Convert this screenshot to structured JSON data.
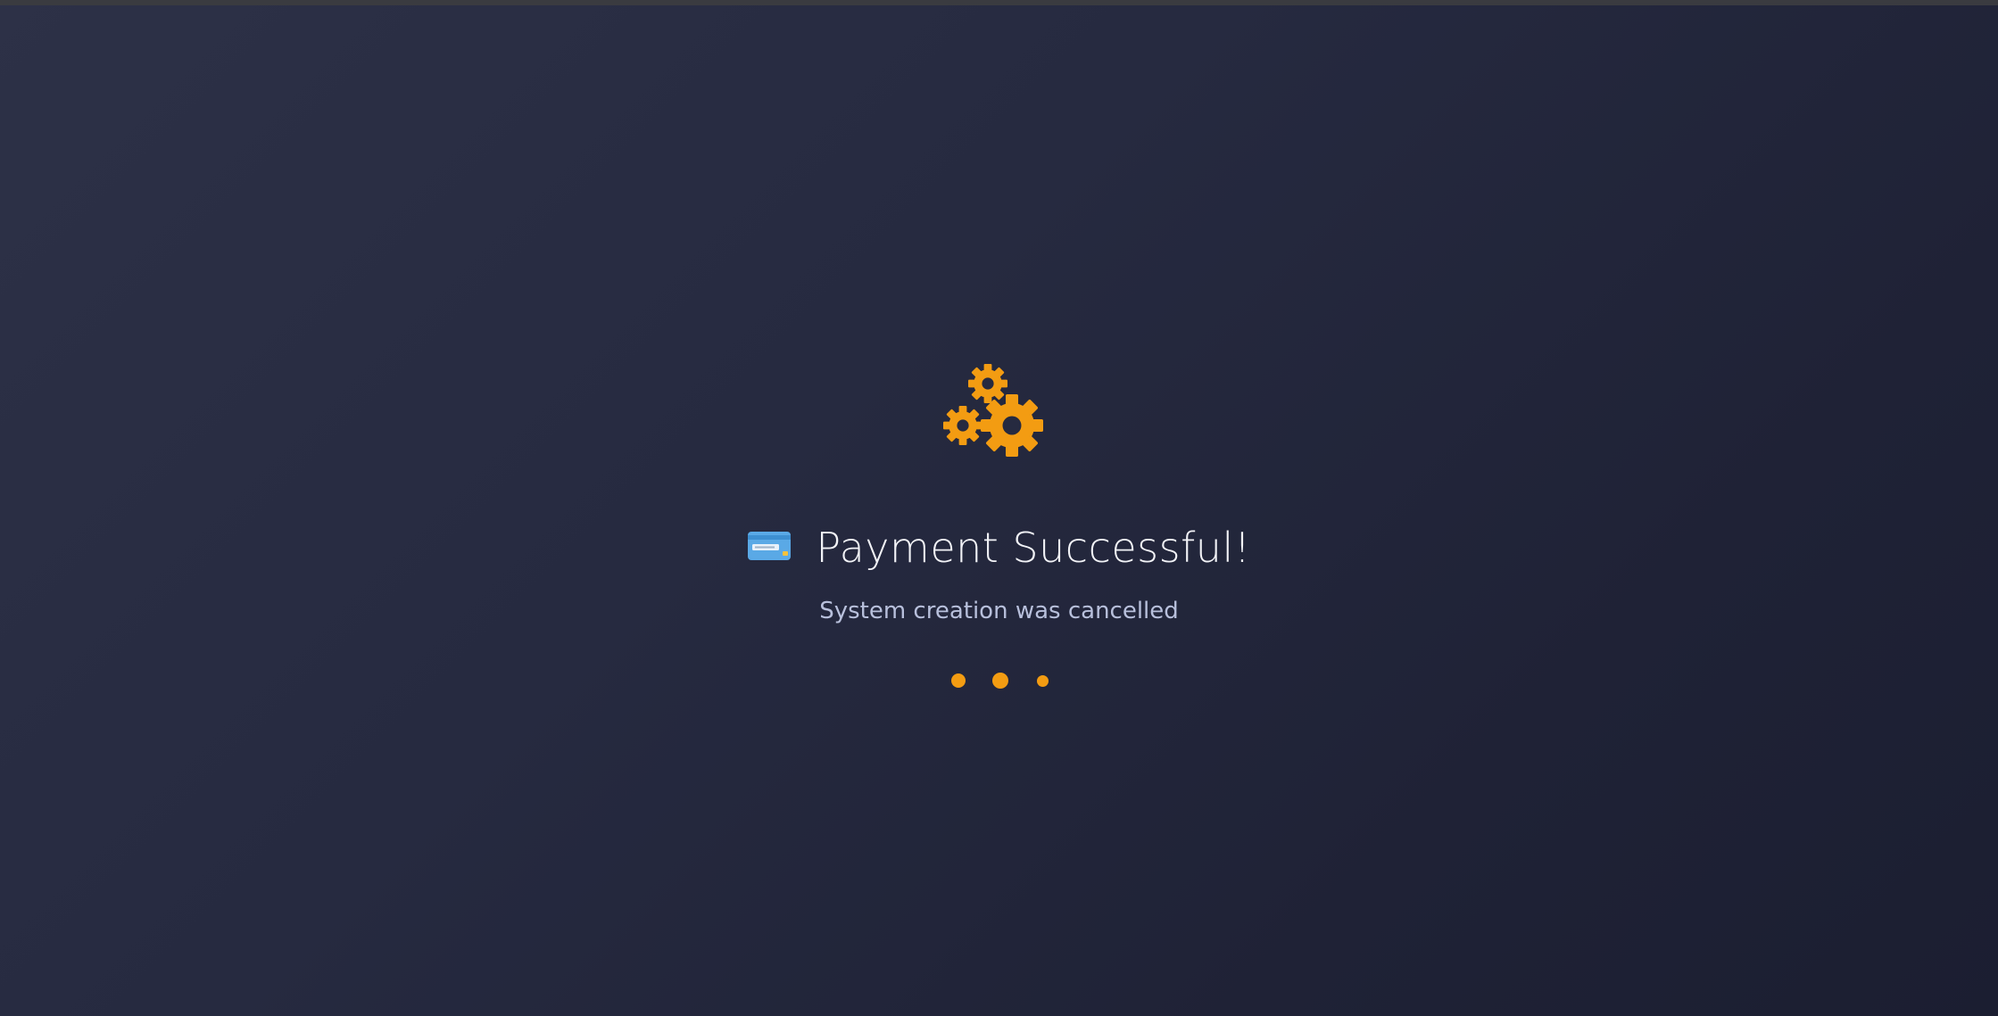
{
  "status": {
    "title": "Payment Successful!",
    "subtitle": "System creation was cancelled"
  },
  "icons": {
    "main": "gears-icon",
    "title": "credit-card-icon",
    "loader": "loading-dots"
  },
  "colors": {
    "accent": "#f39c12",
    "background_start": "#2d3147",
    "background_end": "#1b1e31",
    "title_text": "#f2f3f7",
    "subtitle_text": "#b8c0dc"
  }
}
